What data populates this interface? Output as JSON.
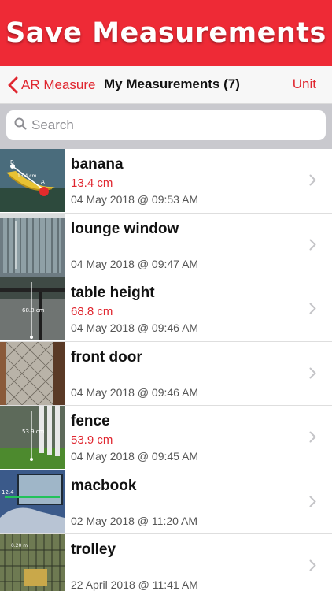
{
  "banner": {
    "title": "Save Measurements"
  },
  "nav": {
    "back_label": "AR Measure",
    "title": "My Measurements (7)",
    "unit_label": "Unit"
  },
  "search": {
    "placeholder": "Search",
    "value": ""
  },
  "measurements": [
    {
      "name": "banana",
      "value": "13.4 cm",
      "date": "04 May 2018 @ 09:53 AM",
      "thumb_label": "13.4 cm",
      "thumb_icon": "banana-photo"
    },
    {
      "name": "lounge window",
      "value": "",
      "date": "04 May 2018 @ 09:47 AM",
      "thumb_label": "",
      "thumb_icon": "window-photo"
    },
    {
      "name": "table height",
      "value": "68.8 cm",
      "date": "04 May 2018 @ 09:46 AM",
      "thumb_label": "68.8 cm",
      "thumb_icon": "table-photo"
    },
    {
      "name": "front door",
      "value": "",
      "date": "04 May 2018 @ 09:46 AM",
      "thumb_label": "",
      "thumb_icon": "door-photo"
    },
    {
      "name": "fence",
      "value": "53.9 cm",
      "date": "04 May 2018 @ 09:45 AM",
      "thumb_label": "53.9 cm",
      "thumb_icon": "fence-photo"
    },
    {
      "name": "macbook",
      "value": "",
      "date": "02 May 2018 @ 11:20 AM",
      "thumb_label": "12.4",
      "thumb_icon": "laptop-photo"
    },
    {
      "name": "trolley",
      "value": "",
      "date": "22 April 2018 @ 11:41 AM",
      "thumb_label": "0.20 m",
      "thumb_icon": "trolley-photo"
    }
  ],
  "colors": {
    "brand_red": "#ee2a36",
    "accent_red": "#e0262f"
  }
}
